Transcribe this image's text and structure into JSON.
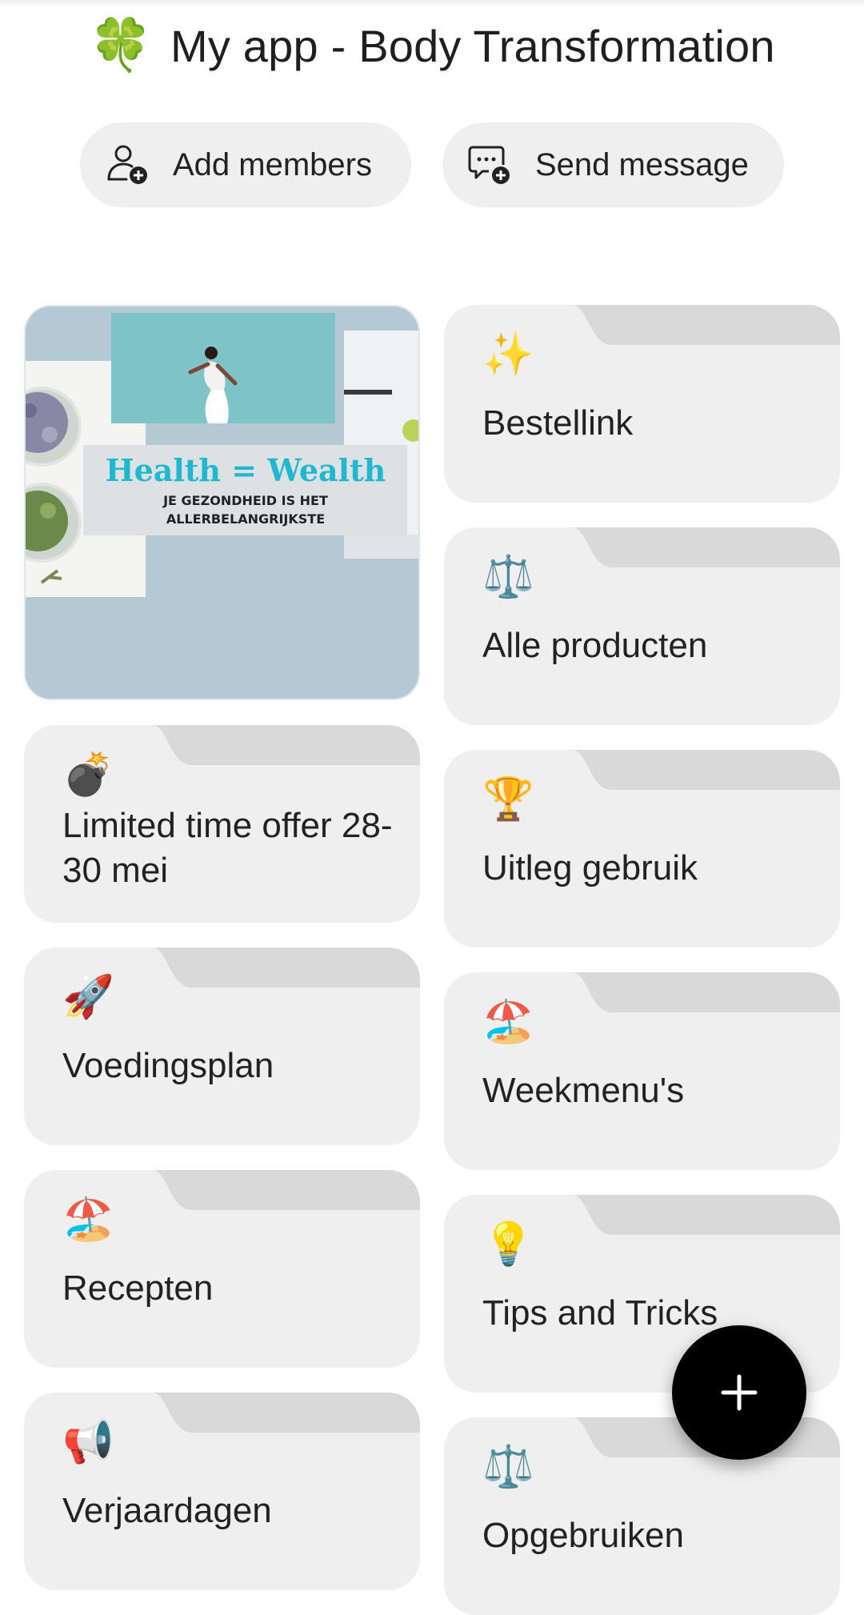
{
  "header": {
    "title_emoji": "🍀",
    "title": "My app - Body Transformation"
  },
  "actions": {
    "add_members": "Add members",
    "send_message": "Send message"
  },
  "featured_image": {
    "headline": "Health = Wealth",
    "subline_1": "JE GEZONDHEID IS HET",
    "subline_2": "ALLERBELANGRIJKSTE"
  },
  "cards": [
    {
      "emoji": "✨",
      "label": "Bestellink"
    },
    {
      "emoji": "⚖️",
      "label": "Alle producten"
    },
    {
      "emoji": "💣",
      "label": "Limited time offer 28-30 mei"
    },
    {
      "emoji": "🏆",
      "label": "Uitleg gebruik"
    },
    {
      "emoji": "🚀",
      "label": "Voedingsplan"
    },
    {
      "emoji": "🏖️",
      "label": "Weekmenu's"
    },
    {
      "emoji": "🏖️",
      "label": "Recepten"
    },
    {
      "emoji": "💡",
      "label": "Tips and Tricks"
    },
    {
      "emoji": "📢",
      "label": "Verjaardagen"
    },
    {
      "emoji": "⚖️",
      "label": "Opgebruiken"
    }
  ],
  "icons": {
    "add_members": "add-person-icon",
    "send_message": "chat-plus-icon",
    "fab": "plus-icon"
  },
  "colors": {
    "card_bg": "#efefef",
    "card_tab": "#d9d9d9",
    "fab_bg": "#000000",
    "headline_accent": "#1fb8d0"
  }
}
